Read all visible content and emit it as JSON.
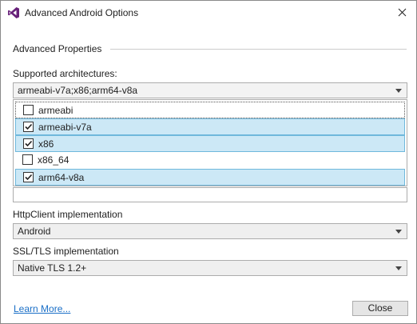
{
  "window": {
    "title": "Advanced Android Options"
  },
  "section": {
    "header": "Advanced Properties"
  },
  "architectures": {
    "label": "Supported architectures:",
    "value": "armeabi-v7a;x86;arm64-v8a",
    "options": [
      {
        "label": "armeabi",
        "checked": false
      },
      {
        "label": "armeabi-v7a",
        "checked": true
      },
      {
        "label": "x86",
        "checked": true
      },
      {
        "label": "x86_64",
        "checked": false
      },
      {
        "label": "arm64-v8a",
        "checked": true
      }
    ]
  },
  "http_client": {
    "label": "HttpClient implementation",
    "value": "Android"
  },
  "ssl_tls": {
    "label": "SSL/TLS implementation",
    "value": "Native TLS 1.2+"
  },
  "footer": {
    "learn_more": "Learn More...",
    "close_label": "Close"
  },
  "colors": {
    "accent": "#1a6fc7",
    "selection": "#cce8f6",
    "selection_border": "#6fb8dc",
    "vs_purple": "#68217a"
  },
  "icons": {
    "app": "visual-studio-logo-icon",
    "close": "close-icon",
    "dropdown": "chevron-down-icon",
    "check": "checkmark-icon"
  }
}
